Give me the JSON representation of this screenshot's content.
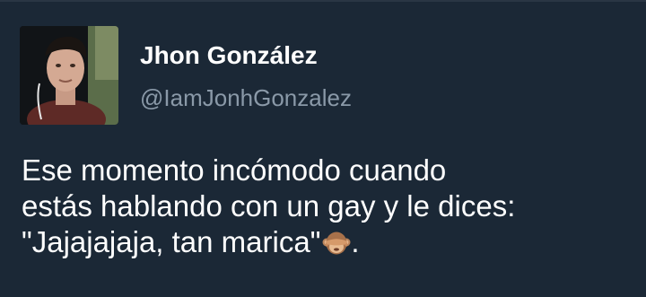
{
  "author": {
    "display_name": "Jhon González",
    "handle": "@IamJonhGonzalez",
    "avatar_icon": "profile-photo"
  },
  "tweet": {
    "lines": [
      "Ese momento incómodo cuando",
      "estás hablando con un gay y le dices:",
      "\"Jajajajaja, tan marica\""
    ],
    "trailing_emoji": "see-no-evil-monkey-icon",
    "trailing_text": "."
  },
  "colors": {
    "background": "#1b2836",
    "name": "#ffffff",
    "handle": "#8a99a8",
    "text": "#ffffff"
  }
}
